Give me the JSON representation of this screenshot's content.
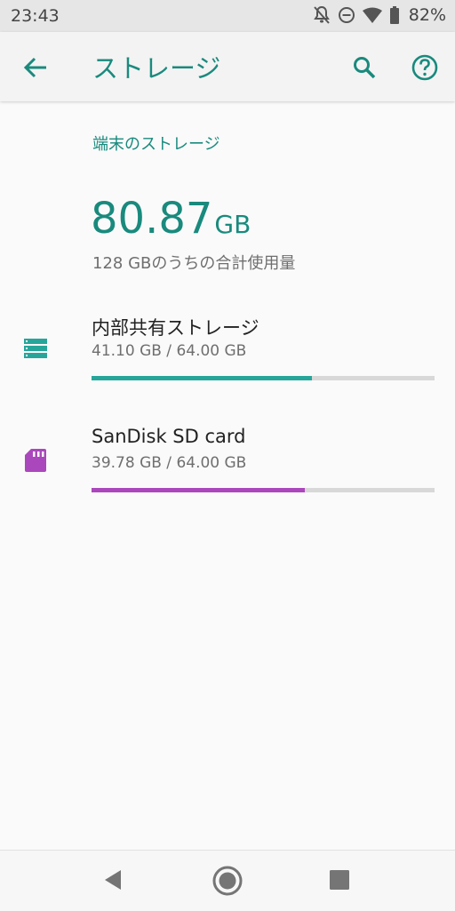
{
  "status_bar": {
    "time": "23:43",
    "battery_percent": "82%",
    "icons": [
      "notifications-off-icon",
      "do-not-disturb-icon",
      "wifi-icon",
      "battery-icon"
    ]
  },
  "app_bar": {
    "title": "ストレージ",
    "back_icon": "arrow-back-icon",
    "search_icon": "search-icon",
    "help_icon": "help-icon"
  },
  "device_storage": {
    "section_title": "端末のストレージ",
    "used_value": "80.87",
    "used_unit": "GB",
    "caption": "128 GBのうちの合計使用量"
  },
  "storage_items": [
    {
      "title": "内部共有ストレージ",
      "summary": "41.10 GB / 64.00 GB",
      "icon": "storage-icon",
      "color": "#26a69a",
      "used_fraction": 0.642
    },
    {
      "title": "SanDisk SD card",
      "summary": "39.78 GB / 64.00 GB",
      "icon": "sd-card-icon",
      "color": "#ab47bc",
      "used_fraction": 0.622
    }
  ],
  "colors": {
    "accent": "#198a7d",
    "status_bar": "#e6e6e6",
    "app_bar": "#f3f3f3",
    "background": "#fafafa",
    "bar_track": "#d8d8d8"
  },
  "nav_bar": {
    "back_icon": "nav-back-icon",
    "home_icon": "nav-home-icon",
    "recents_icon": "nav-recents-icon"
  }
}
